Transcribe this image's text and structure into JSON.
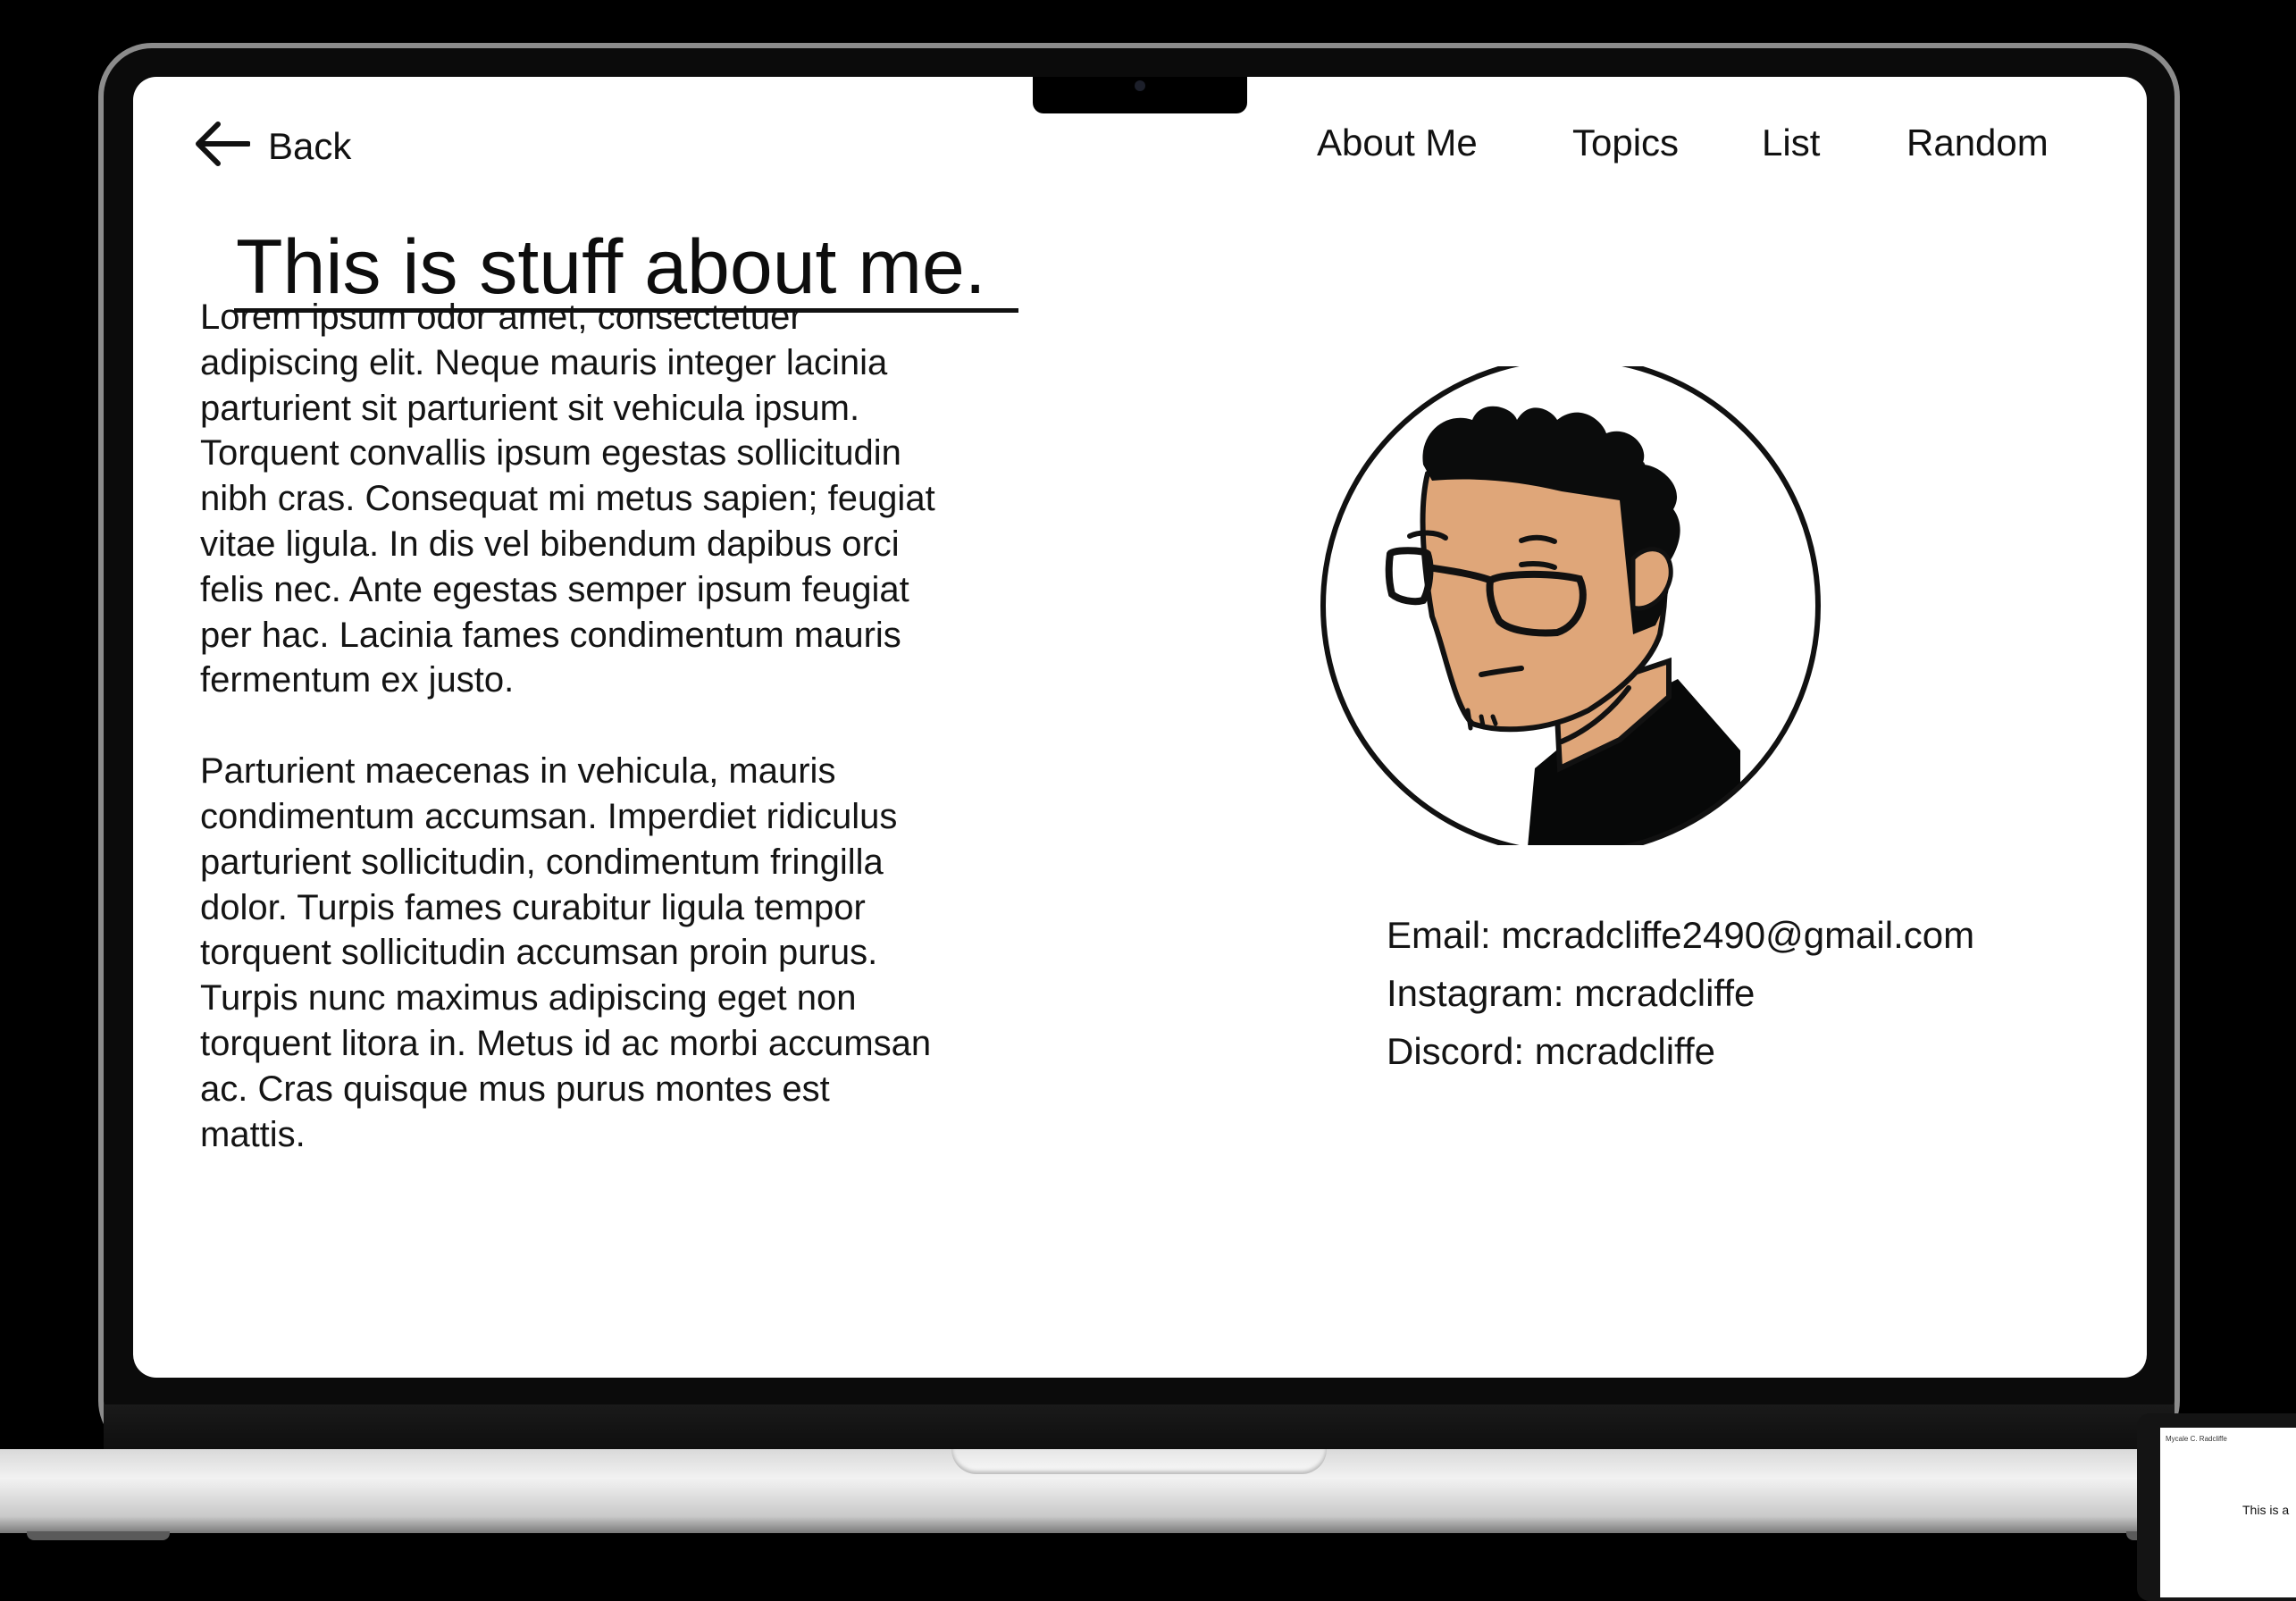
{
  "nav": {
    "back_label": "Back",
    "links": [
      "About Me",
      "Topics",
      "List",
      "Random"
    ]
  },
  "page": {
    "title": "This is stuff about me.",
    "paragraphs": [
      "Lorem ipsum odor amet, consectetuer adipiscing elit. Neque mauris integer lacinia parturient sit parturient sit vehicula ipsum. Torquent convallis ipsum egestas sollicitudin nibh cras. Consequat mi metus sapien; feugiat vitae ligula. In dis vel bibendum dapibus orci felis nec. Ante egestas semper ipsum feugiat per hac. Lacinia fames condimentum mauris fermentum ex justo.",
      "Parturient maecenas in vehicula, mauris condimentum accumsan. Imperdiet ridiculus parturient sollicitudin, condimentum fringilla dolor. Turpis fames curabitur ligula tempor torquent sollicitudin accumsan proin purus. Turpis nunc maximus adipiscing eget non torquent litora in. Metus id ac morbi accumsan ac. Cras quisque mus purus montes est mattis."
    ]
  },
  "contacts": {
    "email": "Email: mcradcliffe2490@gmail.com",
    "instagram": "Instagram: mcradcliffe",
    "discord": "Discord: mcradcliffe"
  },
  "avatar": {
    "icon": "cartoon-portrait-avatar",
    "skin_color": "#dfa679"
  },
  "secondary_device": {
    "brand": "Mycale C. Radcliffe",
    "text": "This is a"
  },
  "icons": {
    "back": "arrow-left-icon"
  }
}
